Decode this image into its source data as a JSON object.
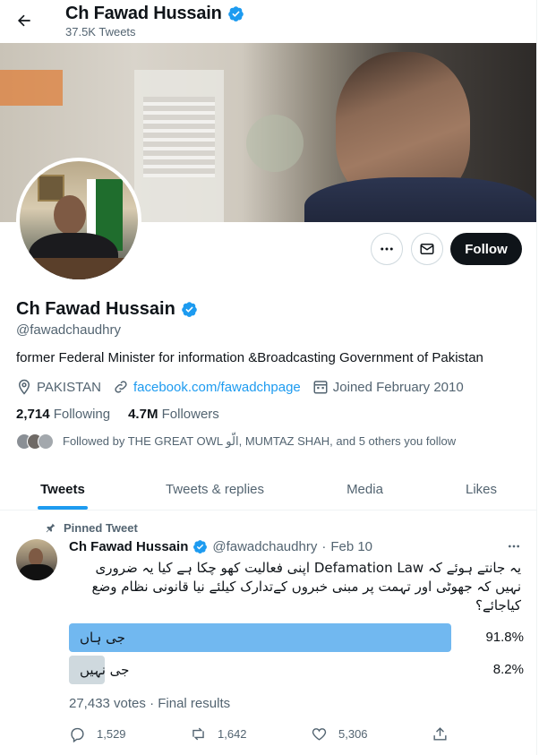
{
  "header": {
    "name": "Ch Fawad Hussain",
    "tweet_count": "37.5K Tweets"
  },
  "profile": {
    "name": "Ch Fawad Hussain",
    "handle": "@fawadchaudhry",
    "bio": "former Federal Minister for information &Broadcasting Government of Pakistan",
    "location": "PAKISTAN",
    "website": "facebook.com/fawadchpage",
    "joined": "Joined February 2010",
    "following_count": "2,714",
    "following_label": "Following",
    "followers_count": "4.7M",
    "followers_label": "Followers",
    "followed_by": "Followed by THE GREAT OWL الّو, MUMTAZ SHAH, and 5 others you follow"
  },
  "actions": {
    "follow_label": "Follow"
  },
  "tabs": [
    {
      "label": "Tweets",
      "active": true
    },
    {
      "label": "Tweets & replies",
      "active": false
    },
    {
      "label": "Media",
      "active": false
    },
    {
      "label": "Likes",
      "active": false
    }
  ],
  "tweet": {
    "pinned_label": "Pinned Tweet",
    "author_name": "Ch Fawad Hussain",
    "author_handle": "@fawadchaudhry",
    "separator": "·",
    "date": "Feb 10",
    "text": "یہ جانتے ہوئے کہ Defamation Law اپنی فعالیت کھو چکا ہے کیا یہ ضروری نہیں کہ جھوٹی اور تہمت پر مبنی خبروں کےتدارک کیلئے نیا قانونی نظام وضع کیاجائے؟",
    "poll": {
      "options": [
        {
          "label": "جی ہاں",
          "percent": "91.8%",
          "share": 0.918,
          "winner": true
        },
        {
          "label": "جی نہیں",
          "percent": "8.2%",
          "share": 0.082,
          "winner": false
        }
      ],
      "votes": "27,433 votes",
      "status": "Final results"
    },
    "stats": {
      "replies": "1,529",
      "retweets": "1,642",
      "likes": "5,306"
    }
  },
  "colors": {
    "accent": "#1d9bf0",
    "poll_winner": "#71b8f0",
    "poll_other": "#cfd9de"
  }
}
